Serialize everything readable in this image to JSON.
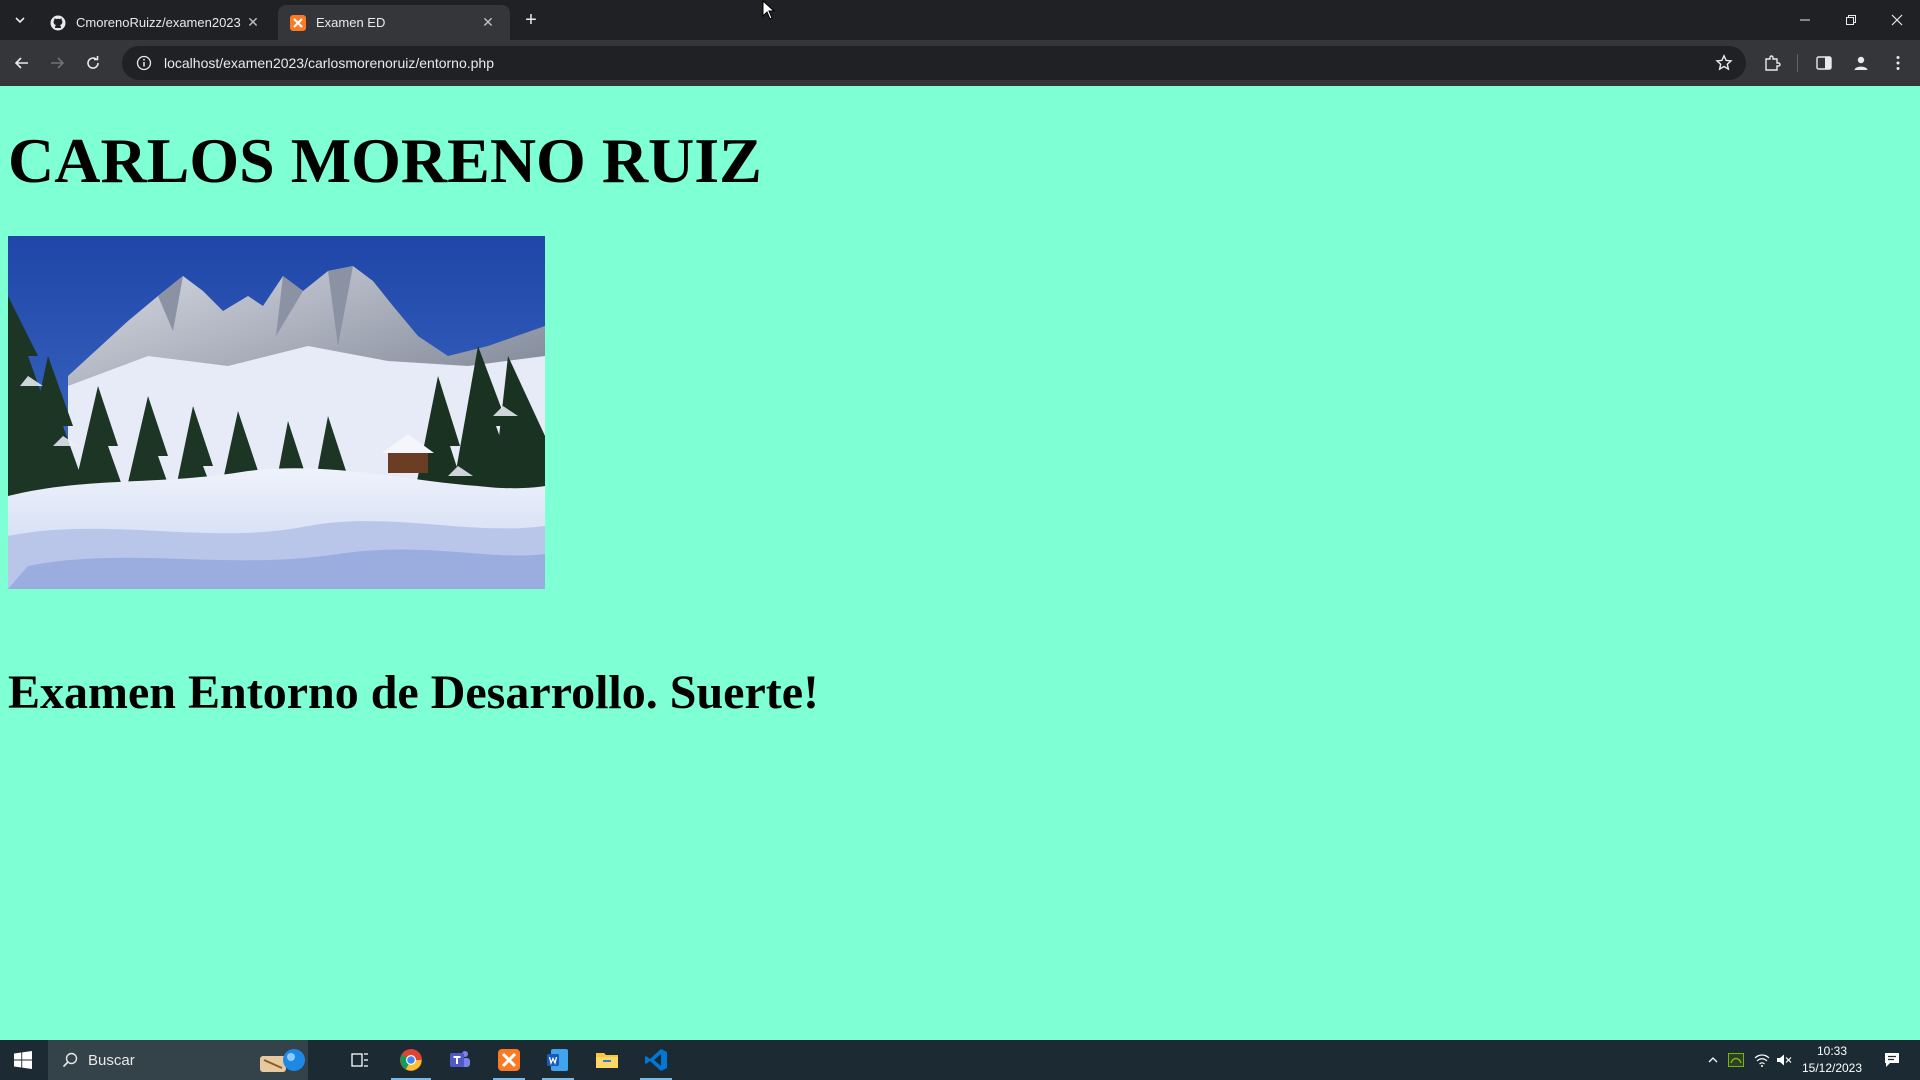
{
  "browser": {
    "tabs": [
      {
        "title": "CmorenoRuizz/examen2023",
        "favicon": "github-icon",
        "active": false
      },
      {
        "title": "Examen ED",
        "favicon": "xampp-icon",
        "active": true
      }
    ],
    "url": "localhost/examen2023/carlosmorenoruiz/entorno.php"
  },
  "page": {
    "heading": "CARLOS MORENO RUIZ",
    "image": {
      "description_icon": "snowy-mountain-landscape-image"
    },
    "subheading": "Examen Entorno de Desarrollo. Suerte!",
    "background_color": "#7fffd4"
  },
  "taskbar": {
    "search_placeholder": "Buscar",
    "apps": [
      "task-view-icon",
      "chrome-icon",
      "teams-icon",
      "xampp-icon",
      "word-icon",
      "file-explorer-icon",
      "vscode-icon"
    ],
    "clock": {
      "time": "10:33",
      "date": "15/12/2023"
    }
  }
}
